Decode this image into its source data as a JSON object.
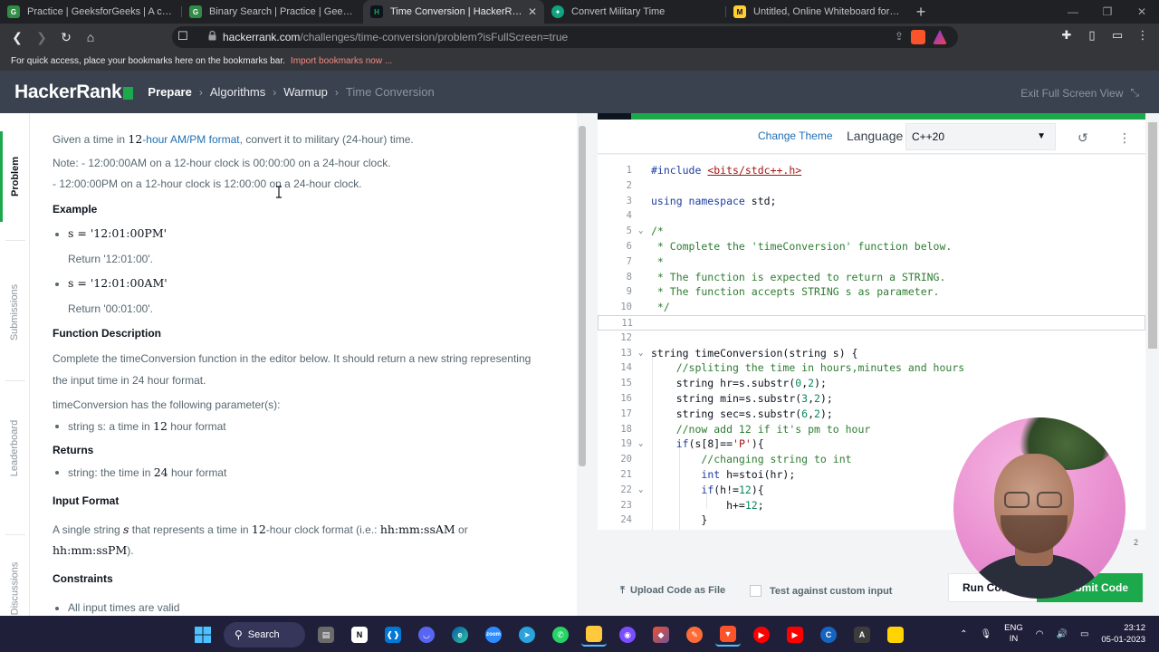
{
  "browser": {
    "tabs": [
      {
        "label": "Practice | GeeksforGeeks | A computer",
        "favicon": "gfg-icon",
        "active": false,
        "color": "#2f8d46"
      },
      {
        "label": "Binary Search | Practice | GeeksforGee",
        "favicon": "gfg-icon",
        "active": false,
        "color": "#2f8d46"
      },
      {
        "label": "Time Conversion | HackerRank",
        "favicon": "hackerrank-icon",
        "active": true,
        "color": "#1ba94c"
      },
      {
        "label": "Convert Military Time",
        "favicon": "openai-icon",
        "active": false,
        "color": "#10a37f"
      },
      {
        "label": "Untitled, Online Whiteboard for Visual",
        "favicon": "miro-icon",
        "active": false,
        "color": "#ffd02f"
      }
    ],
    "url_host": "hackerrank.com",
    "url_path": "/challenges/time-conversion/problem?isFullScreen=true",
    "bookmarks_text": "For quick access, place your bookmarks here on the bookmarks bar.",
    "bookmarks_import": "Import bookmarks now ..."
  },
  "header": {
    "logo": "HackerRank",
    "breadcrumbs": [
      "Prepare",
      "Algorithms",
      "Warmup",
      "Time Conversion"
    ],
    "exit_fullscreen": "Exit Full Screen View"
  },
  "side_tabs": [
    "Problem",
    "Submissions",
    "Leaderboard",
    "Discussions"
  ],
  "problem": {
    "intro_pre": "Given a time in ",
    "intro_num": "12",
    "intro_link": "-hour AM/PM format",
    "intro_post": ", convert it to military (24-hour) time.",
    "note1": "Note: - 12:00:00AM on a 12-hour clock is 00:00:00 on a 24-hour clock.",
    "note2": "- 12:00:00PM on a 12-hour clock is 12:00:00 on a 24-hour clock.",
    "example_heading": "Example",
    "ex1_math": "s = '12:01:00PM'",
    "ex1_return": "Return '12:01:00'.",
    "ex2_math": "s = '12:01:00AM'",
    "ex2_return": "Return '00:01:00'.",
    "func_heading": "Function Description",
    "func_text1": "Complete the timeConversion function in the editor below. It should return a new string representing",
    "func_text2": "the input time in 24 hour format.",
    "params_text": "timeConversion has the following parameter(s):",
    "param1_pre": "string s: a time in ",
    "param1_num": "12",
    "param1_post": " hour format",
    "returns_heading": "Returns",
    "ret1_pre": "string: the time in ",
    "ret1_num": "24",
    "ret1_post": " hour format",
    "input_heading": "Input Format",
    "input_pre": "A single string ",
    "input_var": "s",
    "input_mid": " that represents a time in ",
    "input_num": "12",
    "input_post": "-hour clock format (i.e.: ",
    "input_fmt1": "hh:mm:ssAM",
    "input_or": " or",
    "input_fmt2": "hh:mm:ssPM",
    "input_end": ").",
    "constraints_heading": "Constraints",
    "constraint1": "All input times are valid"
  },
  "editor": {
    "change_theme": "Change Theme",
    "language_label": "Language",
    "language_value": "C++20",
    "upload": "Upload Code as File",
    "test_custom": "Test against custom input",
    "run": "Run Code",
    "submit": "Submit Code",
    "scroll_hint": "2",
    "lines": [
      {
        "n": "1",
        "text": "#include <bits/stdc++.h>",
        "kind": "include"
      },
      {
        "n": "2",
        "text": "",
        "kind": "plain"
      },
      {
        "n": "3",
        "text": "using namespace std;",
        "kind": "using"
      },
      {
        "n": "4",
        "text": "",
        "kind": "plain"
      },
      {
        "n": "5",
        "text": "/*",
        "kind": "comment",
        "fold": true
      },
      {
        "n": "6",
        "text": " * Complete the 'timeConversion' function below.",
        "kind": "comment"
      },
      {
        "n": "7",
        "text": " *",
        "kind": "comment"
      },
      {
        "n": "8",
        "text": " * The function is expected to return a STRING.",
        "kind": "comment"
      },
      {
        "n": "9",
        "text": " * The function accepts STRING s as parameter.",
        "kind": "comment"
      },
      {
        "n": "10",
        "text": " */",
        "kind": "comment"
      },
      {
        "n": "11",
        "text": "",
        "kind": "plain",
        "current": true
      },
      {
        "n": "12",
        "text": "",
        "kind": "plain"
      },
      {
        "n": "13",
        "text": "string timeConversion(string s) {",
        "kind": "plain",
        "fold": true
      },
      {
        "n": "14",
        "text": "    //spliting the time in hours,minutes and hours",
        "kind": "comment"
      },
      {
        "n": "15",
        "text": "    string hr=s.substr(0,2);",
        "kind": "plain"
      },
      {
        "n": "16",
        "text": "    string min=s.substr(3,2);",
        "kind": "plain"
      },
      {
        "n": "17",
        "text": "    string sec=s.substr(6,2);",
        "kind": "plain"
      },
      {
        "n": "18",
        "text": "    //now add 12 if it's pm to hour",
        "kind": "comment"
      },
      {
        "n": "19",
        "text": "    if(s[8]=='P'){",
        "kind": "if",
        "fold": true
      },
      {
        "n": "20",
        "text": "        //changing string to int",
        "kind": "comment"
      },
      {
        "n": "21",
        "text": "        int h=stoi(hr);",
        "kind": "int"
      },
      {
        "n": "22",
        "text": "        if(h!=12){",
        "kind": "if",
        "fold": true
      },
      {
        "n": "23",
        "text": "            h+=12;",
        "kind": "plain"
      },
      {
        "n": "24",
        "text": "        }",
        "kind": "plain"
      }
    ]
  },
  "taskbar": {
    "search": "Search",
    "apps": [
      "file-explorer-icon",
      "notion-icon",
      "vscode-icon",
      "discord-icon",
      "edge-icon",
      "zoom-icon",
      "telegram-icon",
      "whatsapp-icon",
      "folder-icon",
      "github-icon",
      "git-icon",
      "postman-icon",
      "brave-icon",
      "youtube-music-icon",
      "youtube-icon",
      "codeblocks-icon",
      "app-a-icon",
      "sticky-notes-icon"
    ],
    "lang_line1": "ENG",
    "lang_line2": "IN",
    "time": "23:12",
    "date": "05-01-2023"
  },
  "colors": {
    "hackerrank_green": "#1ba94c",
    "header_bg": "#39424e",
    "link_blue": "#1f6fb2"
  }
}
